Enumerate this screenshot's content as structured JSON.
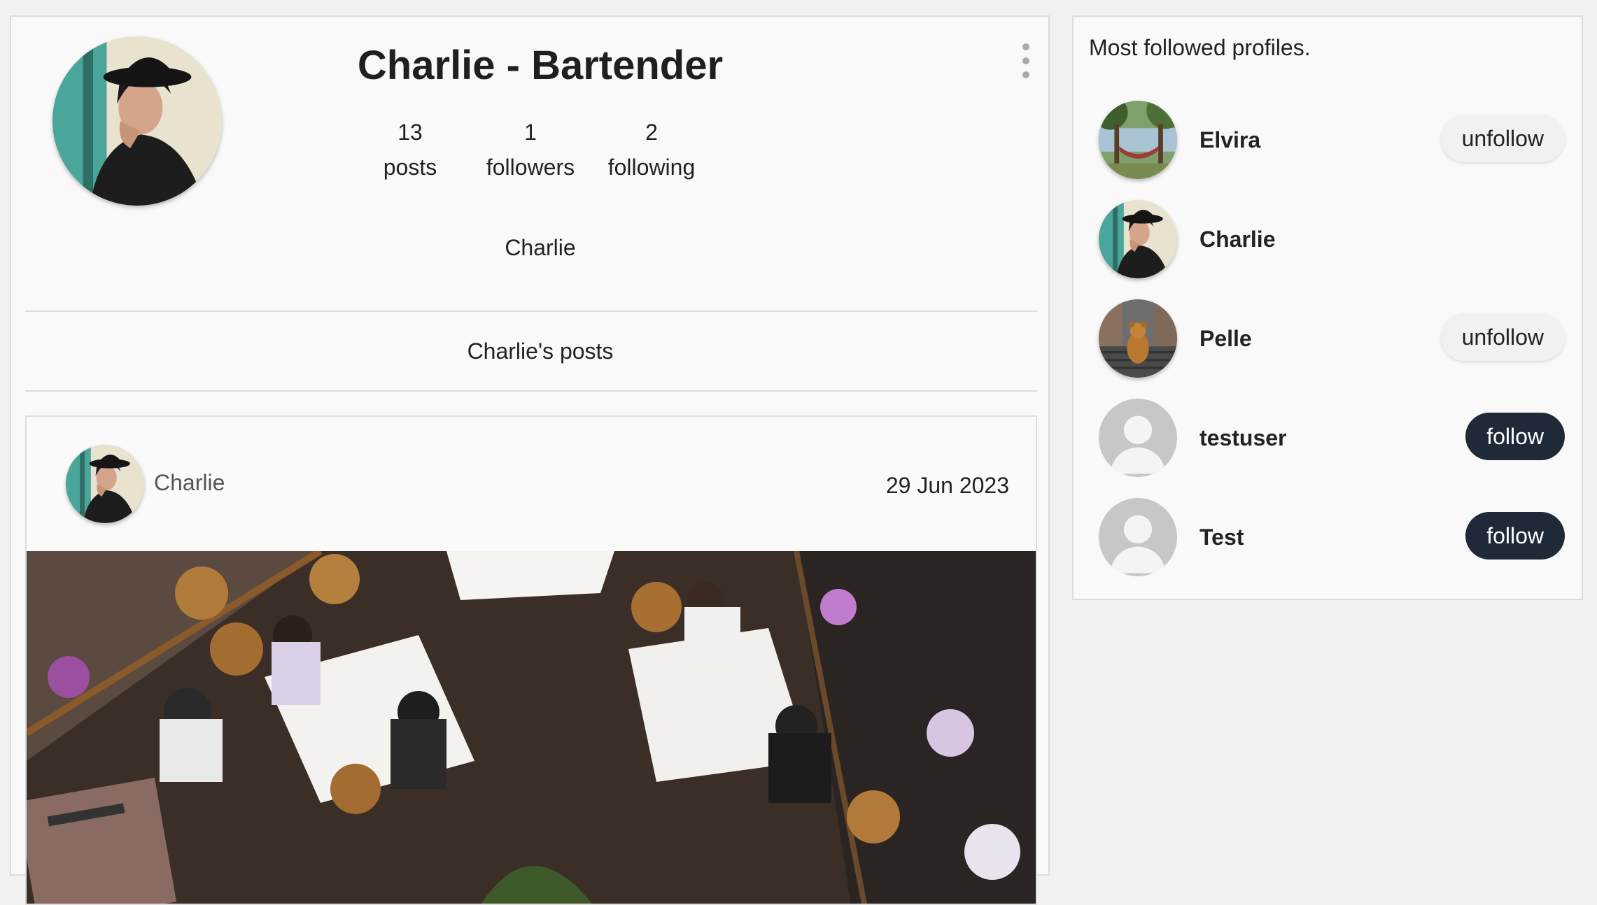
{
  "profile": {
    "title": "Charlie - Bartender",
    "display_name": "Charlie",
    "stats": [
      {
        "value": "13",
        "label": "posts"
      },
      {
        "value": "1",
        "label": "followers"
      },
      {
        "value": "2",
        "label": "following"
      }
    ],
    "menu_icon": "more-vertical-icon"
  },
  "posts_section": {
    "heading": "Charlie's posts",
    "post": {
      "author": "Charlie",
      "date": "29 Jun 2023"
    }
  },
  "sidebar": {
    "title": "Most followed profiles.",
    "profiles": [
      {
        "name": "Elvira",
        "button": "unfollow"
      },
      {
        "name": "Charlie",
        "button": ""
      },
      {
        "name": "Pelle",
        "button": "unfollow"
      },
      {
        "name": "testuser",
        "button": "follow"
      },
      {
        "name": "Test",
        "button": "follow"
      }
    ]
  },
  "colors": {
    "follow_button": "#1f2937",
    "unfollow_button": "#f1f1f1",
    "background": "#f1f1f1"
  }
}
